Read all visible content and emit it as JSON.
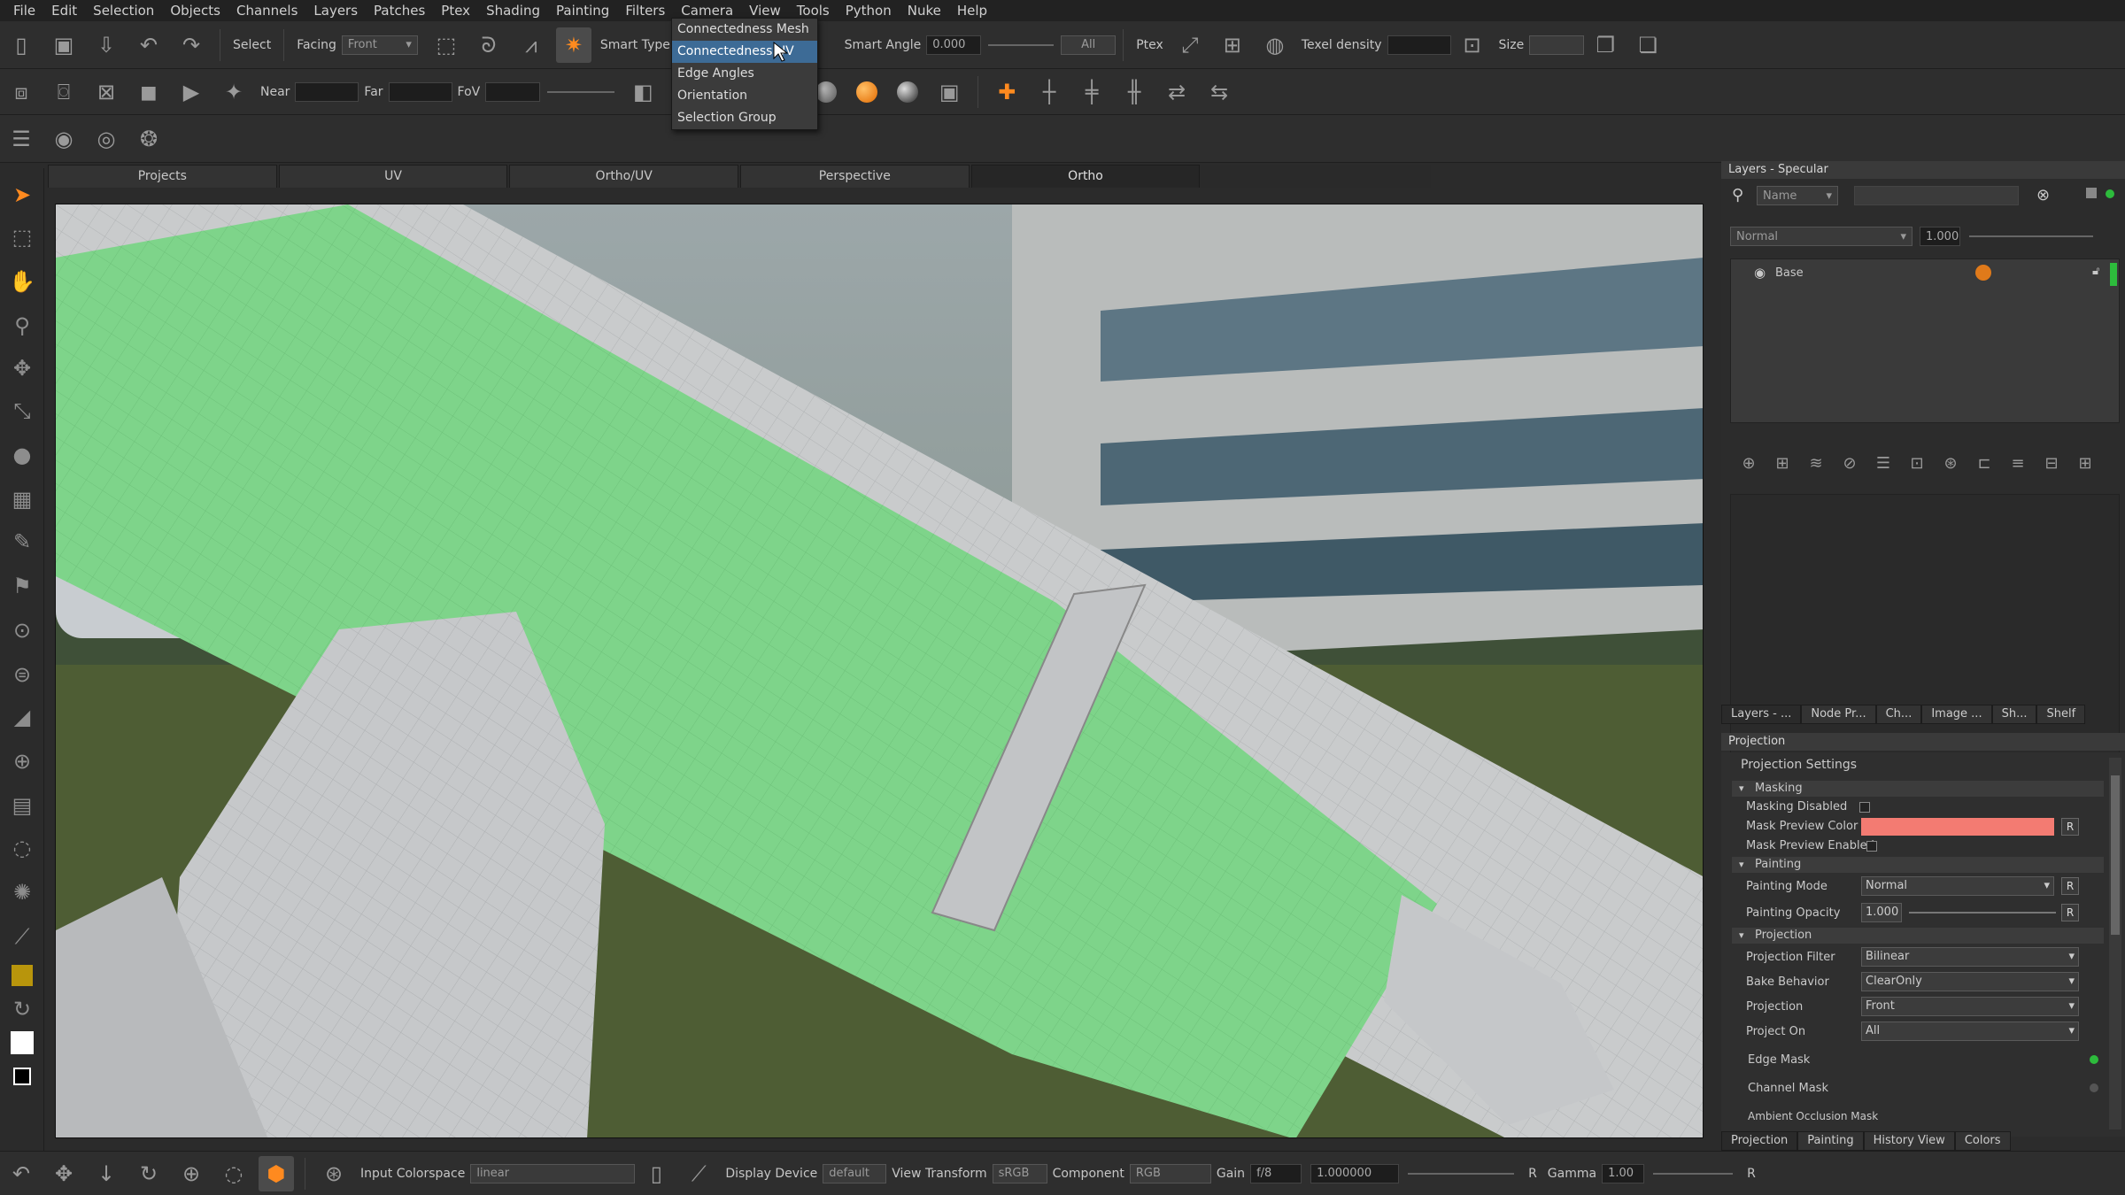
{
  "menubar": {
    "items": [
      "File",
      "Edit",
      "Selection",
      "Objects",
      "Channels",
      "Layers",
      "Patches",
      "Ptex",
      "Shading",
      "Painting",
      "Filters",
      "Camera",
      "View",
      "Tools",
      "Python",
      "Nuke",
      "Help"
    ]
  },
  "toolbar1": {
    "select_label": "Select",
    "facing_label": "Facing",
    "facing_value": "Front",
    "smart_type_label": "Smart Type:",
    "smart_angle_label": "Smart Angle",
    "smart_angle_value": "0.000",
    "all_value": "All",
    "ptex_label": "Ptex",
    "texel_density_label": "Texel density",
    "size_label": "Size"
  },
  "toolbar2": {
    "near_label": "Near",
    "far_label": "Far",
    "fov_label": "FoV"
  },
  "smart_type_dropdown": {
    "items": [
      "Connectedness Mesh",
      "Connectedness UV",
      "Edge Angles",
      "Orientation",
      "Selection Group"
    ],
    "selected_index": 1
  },
  "viewport_tabs": {
    "items": [
      "Projects",
      "UV",
      "Ortho/UV",
      "Perspective",
      "Ortho"
    ],
    "active_index": 4
  },
  "layers_panel": {
    "title": "Layers - Specular",
    "filter_field": "Name",
    "blend_mode": "Normal",
    "opacity": "1.000",
    "layers": [
      {
        "name": "Base"
      }
    ],
    "tabs": [
      "Layers - ...",
      "Node Pr...",
      "Ch...",
      "Image ...",
      "Sh...",
      "Shelf"
    ]
  },
  "projection_panel": {
    "title": "Projection",
    "settings_title": "Projection Settings",
    "masking_section": "Masking",
    "masking_disabled": "Masking Disabled",
    "mask_preview_color": "Mask Preview Color",
    "mask_preview_color_hex": "#f37b72",
    "mask_preview_enabled": "Mask Preview Enabled",
    "painting_section": "Painting",
    "painting_mode_label": "Painting Mode",
    "painting_mode_value": "Normal",
    "painting_opacity_label": "Painting Opacity",
    "painting_opacity_value": "1.000",
    "projection_section": "Projection",
    "projection_filter_label": "Projection Filter",
    "projection_filter_value": "Bilinear",
    "bake_behavior_label": "Bake Behavior",
    "bake_behavior_value": "ClearOnly",
    "projection_label": "Projection",
    "projection_value": "Front",
    "project_on_label": "Project On",
    "project_on_value": "All",
    "edge_mask": "Edge Mask",
    "channel_mask": "Channel Mask",
    "ao_mask": "Ambient Occlusion Mask",
    "reset_label": "R",
    "tabs": [
      "Projection",
      "Painting",
      "History View",
      "Colors"
    ]
  },
  "bottombar": {
    "input_colorspace_label": "Input Colorspace",
    "input_colorspace_value": "linear",
    "display_device_label": "Display Device",
    "display_device_value": "default",
    "view_transform_label": "View Transform",
    "view_transform_value": "sRGB",
    "component_label": "Component",
    "component_value": "RGB",
    "gain_label": "Gain",
    "gain_value": "f/8",
    "gain_number": "1.000000",
    "gamma_label": "Gamma",
    "gamma_value": "1.00",
    "reset_label": "R"
  },
  "colors": {
    "accent": "#ff8a1f",
    "selection_blue": "#3d6b96",
    "mask_green": "#7ed48a",
    "layer_green": "#2dbb3c"
  }
}
